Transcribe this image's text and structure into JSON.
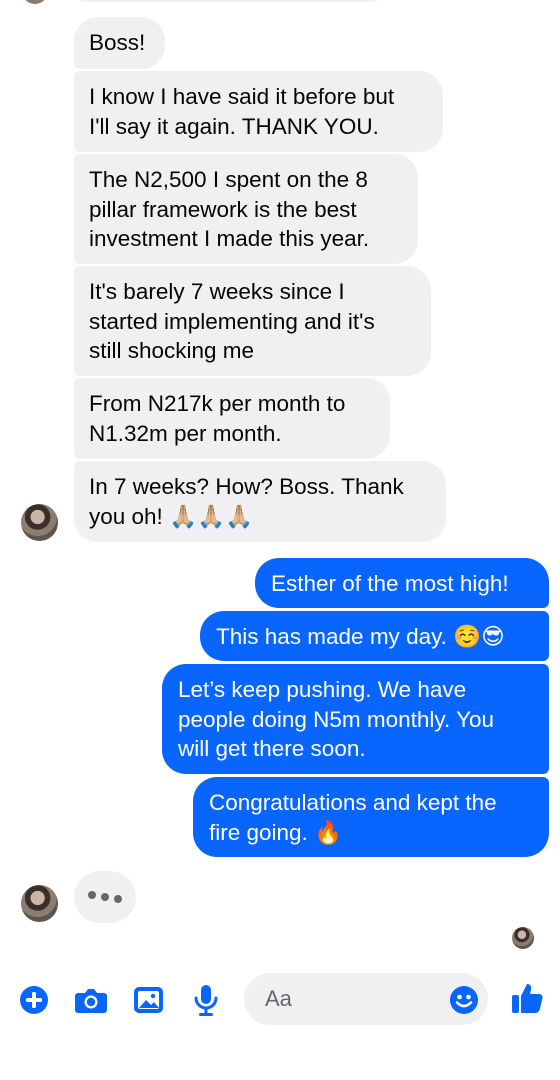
{
  "messages_in": [
    {
      "text": "Boss!"
    },
    {
      "text": "I know I have said it before but\nI'll say it again. THANK YOU."
    },
    {
      "text": "The N2,500 I spent on the 8\npillar framework is the best\ninvestment I made this year."
    },
    {
      "text": "It's barely 7 weeks since I\nstarted implementing and it's\nstill shocking me"
    },
    {
      "text": "From N217k per month to\nN1.32m per month."
    },
    {
      "text": "In 7 weeks? How? Boss. Thank\nyou oh! 🙏🏼🙏🏼🙏🏼"
    }
  ],
  "messages_out": [
    {
      "text": "Esther of the most high!"
    },
    {
      "text": "This has made my day. ☺️😎"
    },
    {
      "text": "Let’s keep pushing. We have\npeople doing N5m monthly. You\nwill get there soon."
    },
    {
      "text": "Congratulations and kept the\nfire going. 🔥"
    }
  ],
  "composer": {
    "placeholder": "Aa",
    "icons": [
      "plus-circle-icon",
      "camera-icon",
      "photo-icon",
      "microphone-icon",
      "emoji-icon",
      "thumbs-up-icon"
    ]
  },
  "colors": {
    "accent": "#0866ff",
    "incoming_bubble": "#f0f0f3",
    "composer_icon": "#0866ff"
  }
}
